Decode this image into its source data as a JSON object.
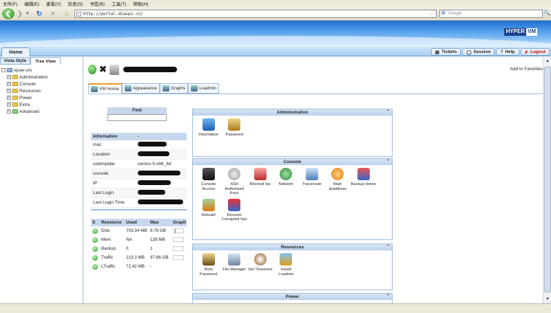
{
  "browser": {
    "menu": [
      "文件(F)",
      "编辑(E)",
      "查看(V)",
      "历史(S)",
      "书签(B)",
      "工具(T)",
      "帮助(H)"
    ],
    "url": "http://portal.diavps.cn/",
    "search_placeholder": "Google"
  },
  "logo": {
    "part1": "HYPER",
    "part2": "VM"
  },
  "top_tab": "Home",
  "top_links": {
    "tickets": "Tickets",
    "session": "Session",
    "help": "Help",
    "logout": "Logout"
  },
  "left": {
    "tabs": [
      "Vista Style",
      "Tree View"
    ],
    "tree": [
      "vpser.vm",
      "Administration",
      "Console",
      "Resources",
      "Power",
      "Extra",
      "Advanced"
    ]
  },
  "main": {
    "add_favorites": "Add to Favorites",
    "tabs": [
      "VM Home",
      "Appearance",
      "Graphs",
      "Lxadmin"
    ],
    "find_label": "Find"
  },
  "info": {
    "header": [
      "Information",
      "-"
    ],
    "rows": [
      {
        "k": "mac",
        "v": ""
      },
      {
        "k": "Location",
        "v": ""
      },
      {
        "k": "ostemplate",
        "v": "centos-5-x86_64"
      },
      {
        "k": "console",
        "v": ""
      },
      {
        "k": "IP",
        "v": ""
      },
      {
        "k": "Last Login",
        "v": ""
      },
      {
        "k": "Last Login Time",
        "v": ""
      }
    ]
  },
  "resources": {
    "header": [
      "S",
      "Resource",
      "Used",
      "Max",
      "Graph"
    ],
    "rows": [
      {
        "name": "Disk",
        "used": "703.34 MB",
        "max": "9.78 GB"
      },
      {
        "name": "Mem",
        "used": "NA",
        "max": "128 MB"
      },
      {
        "name": "Backup",
        "used": "0",
        "max": "1"
      },
      {
        "name": "Traffic",
        "used": "213.3 MB",
        "max": "97.66 GB"
      },
      {
        "name": "LTraffic",
        "used": "72.42 MB",
        "max": "-"
      }
    ]
  },
  "sections": {
    "administration": {
      "title": "Administration",
      "items": [
        "Information",
        "Password"
      ]
    },
    "console": {
      "title": "Console",
      "items": [
        "Console Access",
        "SSH Authorized Keys",
        "Blocked Ips",
        "Network",
        "Traceroute",
        "Main Ipaddress",
        "Backup Home",
        "Rebuild",
        "Recover Corrupted Vps"
      ]
    },
    "resources": {
      "title": "Resources",
      "items": [
        "Root Password",
        "File Manager",
        "Set Timezone",
        "Install Lxadmin"
      ]
    },
    "power": {
      "title": "Power"
    }
  },
  "colors": {
    "banner_blue": "#1e6fd0",
    "header_blue": "#c7d8ee",
    "status_green": "#2d9e2a",
    "logout_red": "#cc0000"
  }
}
